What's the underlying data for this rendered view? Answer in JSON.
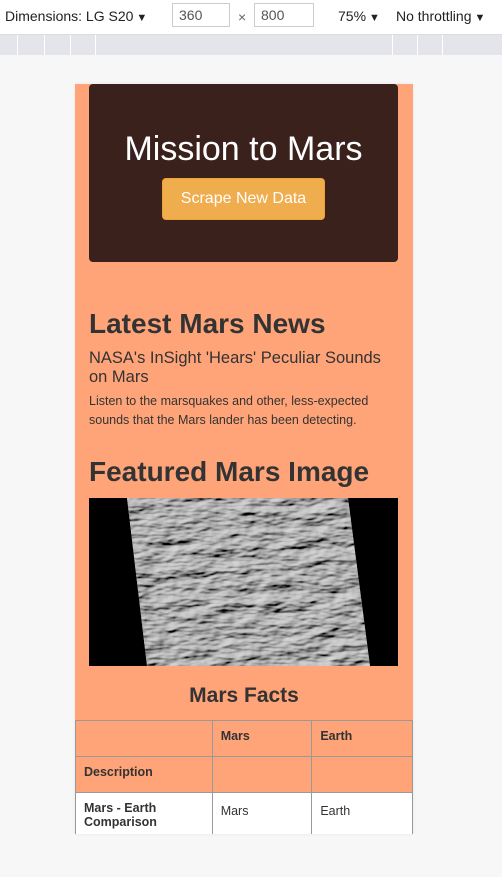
{
  "devtools": {
    "dimensions_label": "Dimensions: LG S20",
    "width_value": "360",
    "times": "×",
    "height_value": "800",
    "zoom": "75%",
    "throttle": "No throttling"
  },
  "page": {
    "title": "Mission to Mars",
    "scrape_button": "Scrape New Data",
    "news_heading": "Latest Mars News",
    "news_title": "NASA's InSight 'Hears' Peculiar Sounds on Mars",
    "news_paragraph": "Listen to the marsquakes and other, less-expected sounds that the Mars lander has been detecting.",
    "image_heading": "Featured Mars Image",
    "facts_heading": "Mars Facts",
    "table": {
      "headers": [
        "",
        "Mars",
        "Earth"
      ],
      "row1": [
        "Description",
        "",
        ""
      ],
      "row2": [
        "Mars - Earth Comparison",
        "Mars",
        "Earth"
      ]
    }
  },
  "colors": {
    "page_bg": "#ffa478",
    "jumbotron_bg": "#3a211c",
    "button_bg": "#f0ad4e"
  }
}
